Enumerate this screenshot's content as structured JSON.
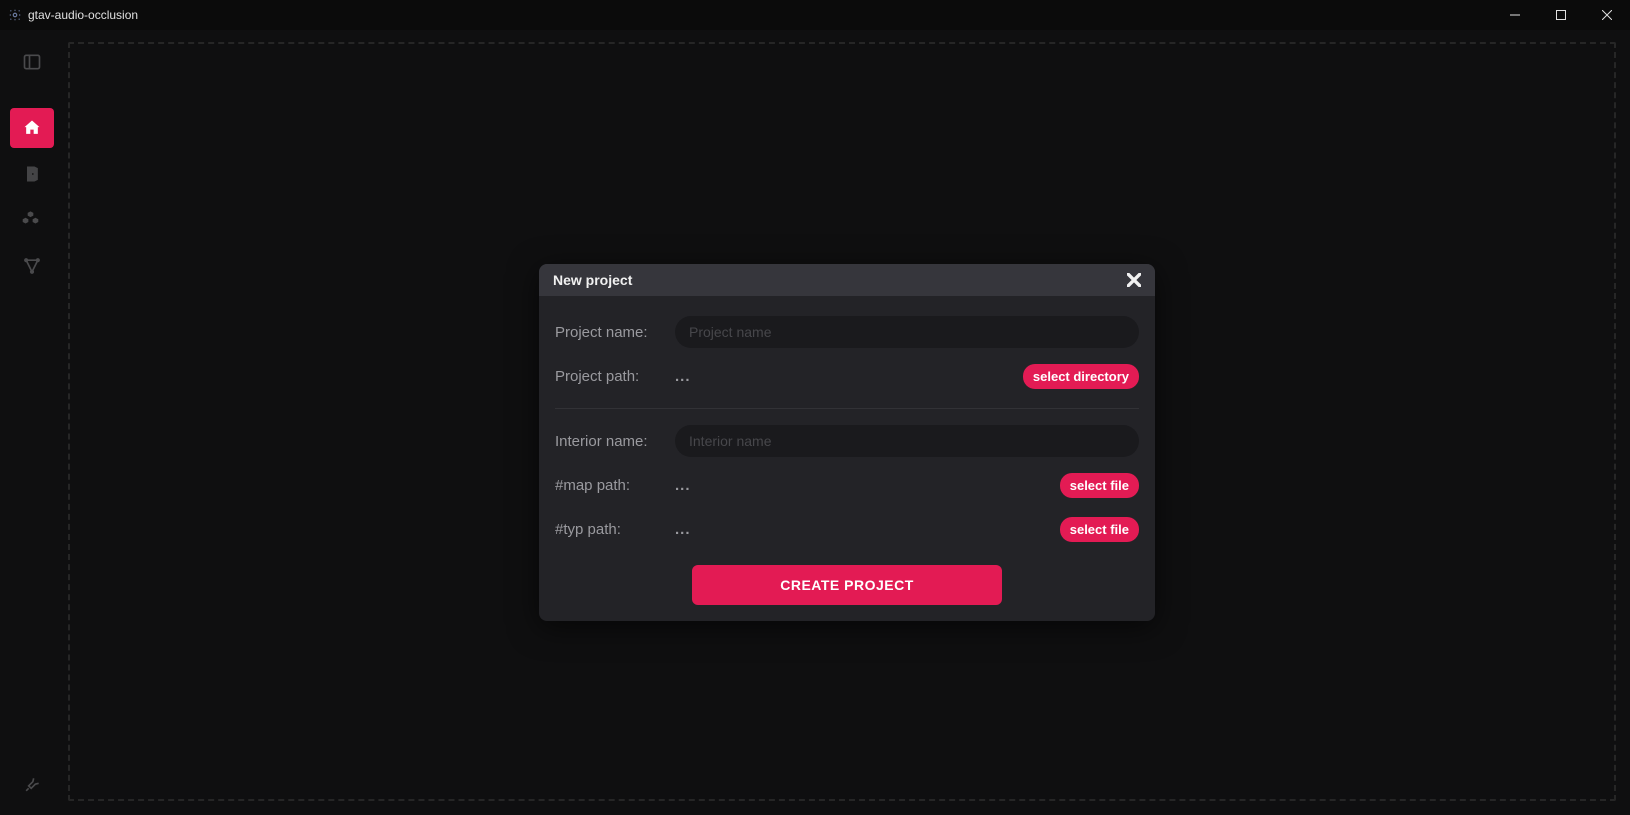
{
  "window": {
    "title": "gtav-audio-occlusion"
  },
  "sidebar": {
    "items": [
      {
        "name": "panel",
        "active": false
      },
      {
        "name": "home",
        "active": true
      },
      {
        "name": "door",
        "active": false
      },
      {
        "name": "cubes",
        "active": false
      },
      {
        "name": "nodes",
        "active": false
      }
    ],
    "bottom": {
      "name": "wrench"
    }
  },
  "modal": {
    "title": "New project",
    "fields": {
      "project_name_label": "Project name:",
      "project_name_placeholder": "Project name",
      "project_name_value": "",
      "project_path_label": "Project path:",
      "project_path_value": "...",
      "select_directory_label": "select directory",
      "interior_name_label": "Interior name:",
      "interior_name_placeholder": "Interior name",
      "interior_name_value": "",
      "map_path_label": "#map path:",
      "map_path_value": "...",
      "typ_path_label": "#typ path:",
      "typ_path_value": "...",
      "select_file_label": "select file"
    },
    "create_label": "CREATE PROJECT"
  },
  "colors": {
    "accent": "#e31b54",
    "bg": "#0f0f10",
    "panel": "#232327",
    "panel_header": "#36363c",
    "input_bg": "#1a1a1d"
  }
}
